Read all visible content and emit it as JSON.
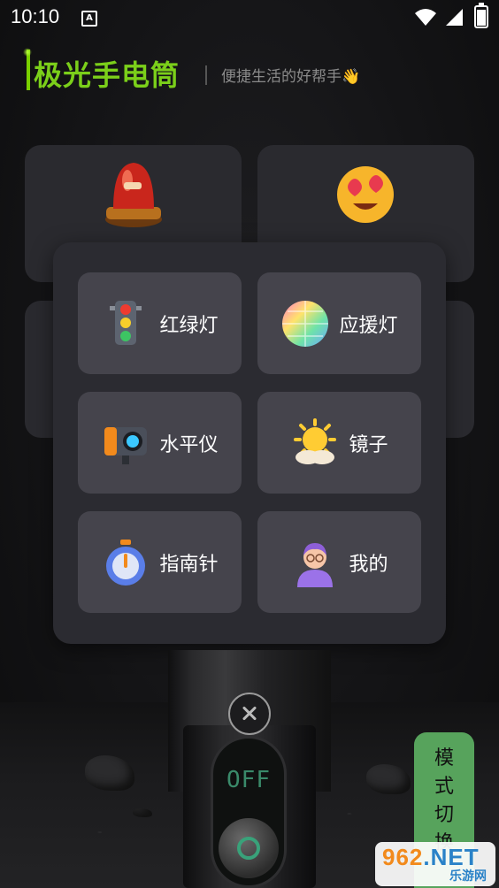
{
  "status_bar": {
    "time": "10:10",
    "notification_icon": "A"
  },
  "header": {
    "title": "极光手电筒",
    "slogan": "便捷生活的好帮手👋"
  },
  "menu": {
    "items": [
      {
        "label": "红绿灯",
        "icon": "traffic-light-icon"
      },
      {
        "label": "应援灯",
        "icon": "glow-ball-icon"
      },
      {
        "label": "水平仪",
        "icon": "camera-level-icon"
      },
      {
        "label": "镜子",
        "icon": "sun-cloud-icon"
      },
      {
        "label": "指南针",
        "icon": "stopwatch-compass-icon"
      },
      {
        "label": "我的",
        "icon": "avatar-icon"
      }
    ]
  },
  "flashlight": {
    "state": "OFF"
  },
  "mode_switch": {
    "label": "模式切换"
  },
  "watermark": {
    "main_prefix": "962",
    "main_suffix": ".NET",
    "sub": "乐游网"
  }
}
